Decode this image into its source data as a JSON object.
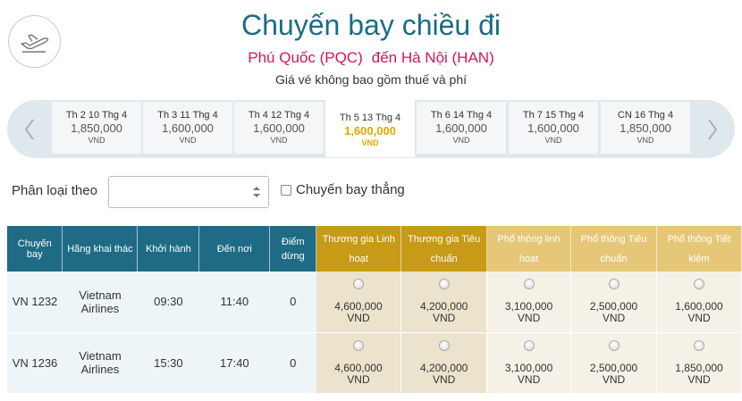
{
  "header": {
    "title": "Chuyến bay chiều đi",
    "route_from": "Phú Quốc (PQC)",
    "route_to": "đến Hà Nội (HAN)",
    "fee_note": "Giá vé không bao gồm thuế và phí"
  },
  "dates": [
    {
      "label": "Th 2 10 Thg 4",
      "price": "1,850,000",
      "currency": "VND",
      "selected": false
    },
    {
      "label": "Th 3 11 Thg 4",
      "price": "1,600,000",
      "currency": "VND",
      "selected": false
    },
    {
      "label": "Th 4 12 Thg 4",
      "price": "1,600,000",
      "currency": "VND",
      "selected": false
    },
    {
      "label": "Th 5 13 Thg 4",
      "price": "1,600,000",
      "currency": "VND",
      "selected": true
    },
    {
      "label": "Th 6 14 Thg 4",
      "price": "1,600,000",
      "currency": "VND",
      "selected": false
    },
    {
      "label": "Th 7 15 Thg 4",
      "price": "1,600,000",
      "currency": "VND",
      "selected": false
    },
    {
      "label": "CN 16 Thg 4",
      "price": "1,850,000",
      "currency": "VND",
      "selected": false
    }
  ],
  "filters": {
    "sort_label": "Phân loại theo",
    "sort_value": "",
    "nonstop_label": "Chuyến bay thẳng",
    "nonstop_checked": false
  },
  "table": {
    "headers": {
      "flight": "Chuyến bay",
      "airline": "Hãng khai thác",
      "depart": "Khởi hành",
      "arrive": "Đến nơi",
      "stops": "Điểm dừng",
      "fares": [
        "Thương gia Linh hoạt",
        "Thương gia Tiêu chuẩn",
        "Phổ thông linh hoạt",
        "Phổ thông Tiêu chuẩn",
        "Phổ thông Tiết kiệm"
      ]
    },
    "rows": [
      {
        "flight": "VN 1232",
        "airline": "Vietnam Airlines",
        "depart": "09:30",
        "arrive": "11:40",
        "stops": "0",
        "fares": [
          {
            "amount": "4,600,000",
            "currency": "VND"
          },
          {
            "amount": "4,200,000",
            "currency": "VND"
          },
          {
            "amount": "3,100,000",
            "currency": "VND"
          },
          {
            "amount": "2,500,000",
            "currency": "VND"
          },
          {
            "amount": "1,600,000",
            "currency": "VND"
          }
        ]
      },
      {
        "flight": "VN 1236",
        "airline": "Vietnam Airlines",
        "depart": "15:30",
        "arrive": "17:40",
        "stops": "0",
        "fares": [
          {
            "amount": "4,600,000",
            "currency": "VND"
          },
          {
            "amount": "4,200,000",
            "currency": "VND"
          },
          {
            "amount": "3,100,000",
            "currency": "VND"
          },
          {
            "amount": "2,500,000",
            "currency": "VND"
          },
          {
            "amount": "1,850,000",
            "currency": "VND"
          }
        ]
      }
    ]
  },
  "icons": {
    "departure": "airplane-takeoff-icon",
    "prev": "chevron-left-icon",
    "next": "chevron-right-icon",
    "spinner": "spinner-arrows-icon"
  },
  "colors": {
    "title": "#1a6d86",
    "route": "#d4145a",
    "header_info": "#1f6b86",
    "header_business": "#c79a18",
    "header_economy": "#e6c777",
    "selected_price": "#e2a700"
  }
}
